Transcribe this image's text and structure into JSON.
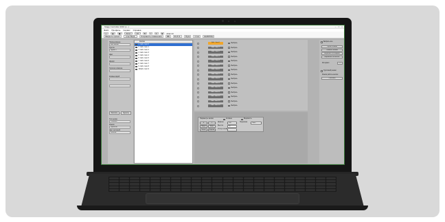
{
  "app": {
    "title": "Stage Controller 2016 (v...)",
    "window_controls": [
      "–",
      "□",
      "×"
    ],
    "menu": [
      "Файл",
      "Профиль",
      "Сервис",
      "Справка"
    ],
    "toolbar1": {
      "font": "Arial",
      "size": "10",
      "text": "Arial 10"
    },
    "toolbar2": {
      "items": [
        "Закрыть проект",
        "Arial Black",
        "Сохранить изменения",
        "ВВ",
        "Ф.И.О.",
        "Пуск",
        "Стоп",
        "ШАБЛОН"
      ]
    }
  },
  "left_panel": {
    "fields": [
      {
        "label": "Наименование",
        "value": "Имя кнопки"
      },
      {
        "label": "Группа",
        "value": "Группа 1"
      },
      {
        "label": "Цвет",
        "value": ""
      },
      {
        "label": "Шрифт",
        "value": ""
      },
      {
        "label": "Горячая клавиша",
        "value": ""
      },
      {
        "label": "Комментарий",
        "value": ""
      }
    ],
    "buttons": [
      "Записать",
      "Удалить"
    ],
    "extra_fields": [
      {
        "label": "Тип кнопки",
        "value": "Обычная"
      },
      {
        "label": "Режим",
        "value": "Пуск/стоп"
      },
      {
        "label": "Цвет активной",
        "value": "Желтый"
      }
    ]
  },
  "list_panel": {
    "header": "Кнопка",
    "rows": [
      {
        "num": "1",
        "label": "Edit - Item 0",
        "selected": true
      },
      {
        "num": "2",
        "label": "Edit - Item 1",
        "selected": false
      },
      {
        "num": "3",
        "label": "Edit - Item 2",
        "selected": false
      },
      {
        "num": "4",
        "label": "Edit - Item 3",
        "selected": false
      },
      {
        "num": "5",
        "label": "Edit - Item 4",
        "selected": false
      },
      {
        "num": "6",
        "label": "Edit - Item 5",
        "selected": false
      },
      {
        "num": "7",
        "label": "Edit - Item 6",
        "selected": false
      },
      {
        "num": "8",
        "label": "Edit - Item 7",
        "selected": false
      },
      {
        "num": "9",
        "label": "Edit - Item 8",
        "selected": false
      },
      {
        "num": "10",
        "label": "Edit - Item 9",
        "selected": false
      }
    ]
  },
  "button_grid": {
    "rows": [
      {
        "idx": "1",
        "label": "Edit - Item 0",
        "active": true,
        "check": "Выбрать"
      },
      {
        "idx": "2",
        "label": "Edit - Item 1",
        "active": false,
        "check": "Выбрать"
      },
      {
        "idx": "3",
        "label": "Edit - Item 2",
        "active": false,
        "check": "Выбрать"
      },
      {
        "idx": "4",
        "label": "Edit - Item 3",
        "active": false,
        "check": "Выбрать"
      },
      {
        "idx": "5",
        "label": "Edit - Item 4",
        "active": false,
        "check": "Выбрать"
      },
      {
        "idx": "6",
        "label": "Edit - Item 5",
        "active": false,
        "check": "Выбрать"
      },
      {
        "idx": "7",
        "label": "Edit - Item 6",
        "active": false,
        "check": "Выбрать"
      },
      {
        "idx": "8",
        "label": "Edit - Item 7",
        "active": false,
        "check": "Выбрать"
      },
      {
        "idx": "9",
        "label": "Edit - Item 8",
        "active": false,
        "check": "Выбрать"
      },
      {
        "idx": "10",
        "label": "Edit - Item 9",
        "active": false,
        "check": "Выбрать"
      },
      {
        "idx": "11",
        "label": "Edit - Item 10",
        "active": false,
        "check": "Выбрать"
      },
      {
        "idx": "12",
        "label": "Edit - Item 11",
        "active": false,
        "check": "Выбрать"
      },
      {
        "idx": "13",
        "label": "Edit - Item 12",
        "active": false,
        "check": "Выбрать"
      },
      {
        "idx": "14",
        "label": "Edit - Item 13",
        "active": false,
        "check": "Выбрать"
      },
      {
        "idx": "15",
        "label": "Edit - Item 14",
        "active": false,
        "check": "Выбрать"
      }
    ]
  },
  "bottom_panel": {
    "title": "Параметры кнопки",
    "check1": "Активна",
    "check2": "Видимость",
    "col_labels": [
      "X",
      "Y"
    ],
    "buttons": [
      "Вверх",
      "Вниз",
      "Влево",
      "Вправо"
    ],
    "field_labels": [
      "Ширина",
      "Высота",
      "Отступ слева",
      "Подсказка"
    ],
    "field_values": [
      "120",
      "20",
      "",
      "Текст"
    ]
  },
  "right_panel": {
    "check_title": "Выбрать все",
    "buttons": [
      "Скрыть кнопки",
      "Показать кнопки",
      "Выровнять по ширине",
      "Выровнять по высоте"
    ],
    "interval_label": "Интервал",
    "interval_value": "1",
    "check2": "Групповой режим",
    "mode_label": "Режим работы кнопки",
    "mode_value": "Обычный"
  },
  "colors": {
    "accent_active": "#f1a62b",
    "selection": "#2f6fd1",
    "panel": "#c0c0c0"
  }
}
